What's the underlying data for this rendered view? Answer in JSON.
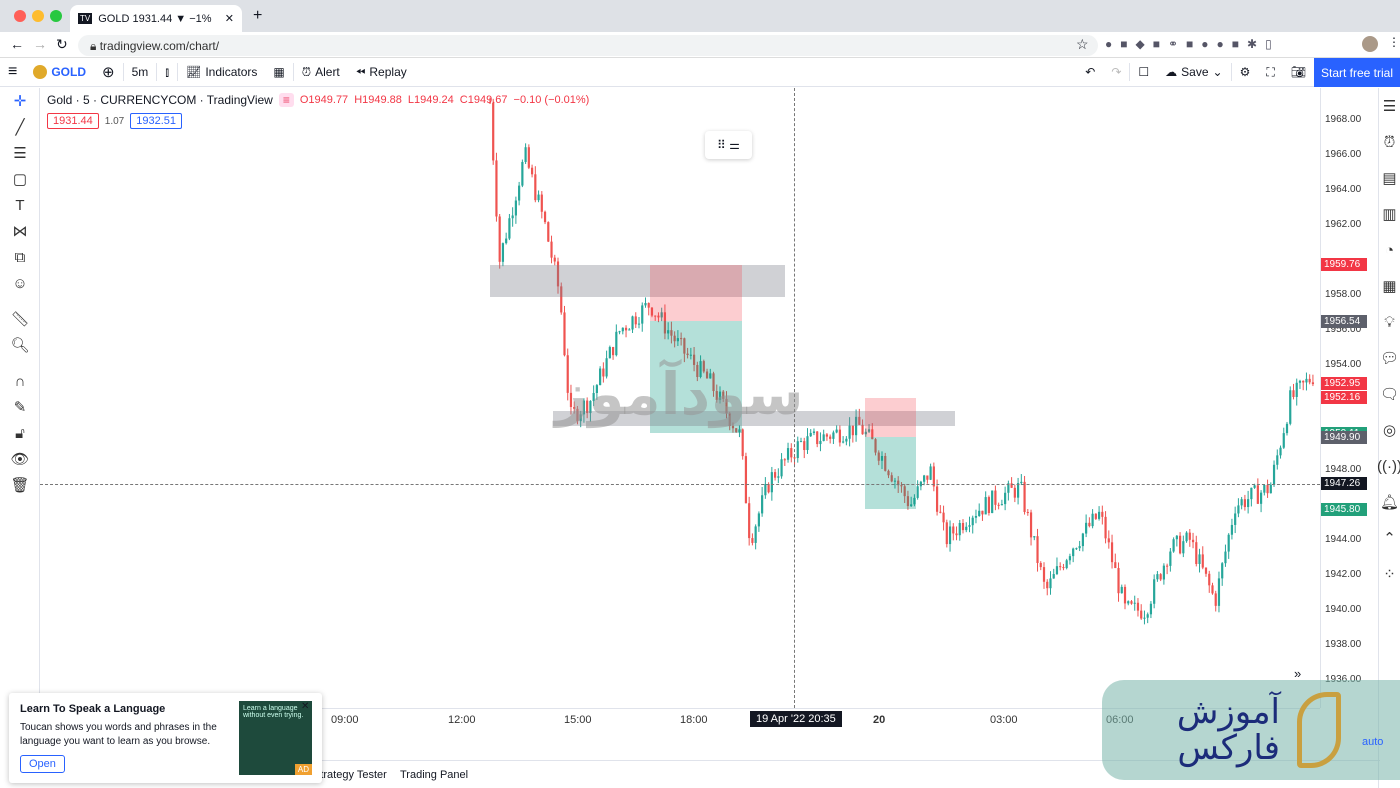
{
  "browser": {
    "tab_title": "GOLD 1931.44 ▼ −1%",
    "url": "tradingview.com/chart/"
  },
  "toolbar": {
    "symbol": "GOLD",
    "interval": "5m",
    "indicators": "Indicators",
    "alert": "Alert",
    "replay": "Replay",
    "save": "Save",
    "trial": "Start free trial"
  },
  "legend": {
    "title": "Gold · 5 · CURRENCYCOM · TradingView",
    "o": "O1949.77",
    "h": "H1949.88",
    "l": "L1949.24",
    "c": "C1949.67",
    "change": "−0.10 (−0.01%)",
    "bid": "1931.44",
    "spread": "1.07",
    "ask": "1932.51"
  },
  "price_axis": {
    "ticks": [
      "1968.00",
      "1966.00",
      "1964.00",
      "1962.00",
      "1958.00",
      "1956.00",
      "1954.00",
      "1948.00",
      "1944.00",
      "1942.00",
      "1940.00",
      "1938.00",
      "1936.00"
    ],
    "labels": [
      {
        "text": "1959.76",
        "color": "#f23645"
      },
      {
        "text": "1956.54",
        "color": "#5d606b"
      },
      {
        "text": "1952.95",
        "color": "#f23645"
      },
      {
        "text": "1952.16",
        "color": "#f23645"
      },
      {
        "text": "1950.11",
        "color": "#22a07a"
      },
      {
        "text": "1949.90",
        "color": "#5d606b"
      },
      {
        "text": "1947.26",
        "color": "#131722"
      },
      {
        "text": "1945.80",
        "color": "#22a07a"
      }
    ]
  },
  "time_axis": {
    "ticks": [
      "09:00",
      "12:00",
      "15:00",
      "18:00",
      "20",
      "03:00",
      "06:00"
    ],
    "crosshair": "19 Apr '22  20:35"
  },
  "bottom": {
    "tabs": [
      "Strategy Tester",
      "Trading Panel"
    ],
    "auto": "auto"
  },
  "ad": {
    "title": "Learn To Speak a Language",
    "body": "Toucan shows you words and phrases in the language you want to learn as you browse.",
    "button": "Open",
    "image_text": "Learn a language without even trying.",
    "badge": "AD"
  },
  "watermark": "سودآموز",
  "logo": {
    "line1": "آموزش",
    "line2": "فارکس"
  },
  "colors": {
    "up": "#26a69a",
    "down": "#ef5350",
    "accent": "#2962ff"
  },
  "chart_data": {
    "type": "candlestick",
    "interval": "5m",
    "price_path": [
      [
        "19 12:44",
        1969
      ],
      [
        "19 12:59",
        1960
      ],
      [
        "19 13:38",
        1966
      ],
      [
        "19 14:09",
        1962
      ],
      [
        "19 14:32",
        1958
      ],
      [
        "19 14:48",
        1951
      ],
      [
        "19 15:19",
        1952
      ],
      [
        "19 16:05",
        1956
      ],
      [
        "19 16:51",
        1957.5
      ],
      [
        "19 17:38",
        1955
      ],
      [
        "19 18:24",
        1953
      ],
      [
        "19 19:10",
        1950
      ],
      [
        "19 19:26",
        1944
      ],
      [
        "19 19:57",
        1947.5
      ],
      [
        "19 20:43",
        1949.5
      ],
      [
        "19 21:29",
        1950
      ],
      [
        "19 22:15",
        1950.5
      ],
      [
        "19 22:46",
        1949
      ],
      [
        "20 00:36",
        1946
      ],
      [
        "20 01:07",
        1948
      ],
      [
        "20 01:30",
        1944
      ],
      [
        "20 02:09",
        1945.5
      ],
      [
        "20 02:55",
        1946.5
      ],
      [
        "20 03:26",
        1947
      ],
      [
        "20 04:05",
        1941
      ],
      [
        "20 04:43",
        1943.5
      ],
      [
        "20 05:29",
        1945.5
      ],
      [
        "20 06:08",
        1940
      ],
      [
        "20 06:39",
        1940
      ],
      [
        "20 07:17",
        1943.5
      ],
      [
        "20 07:48",
        1944
      ],
      [
        "20 08:27",
        1940.5
      ],
      [
        "20 08:58",
        1946
      ],
      [
        "20 09:52",
        1947
      ],
      [
        "20 10:23",
        1952
      ],
      [
        "20 11:01",
        1953.5
      ]
    ]
  }
}
